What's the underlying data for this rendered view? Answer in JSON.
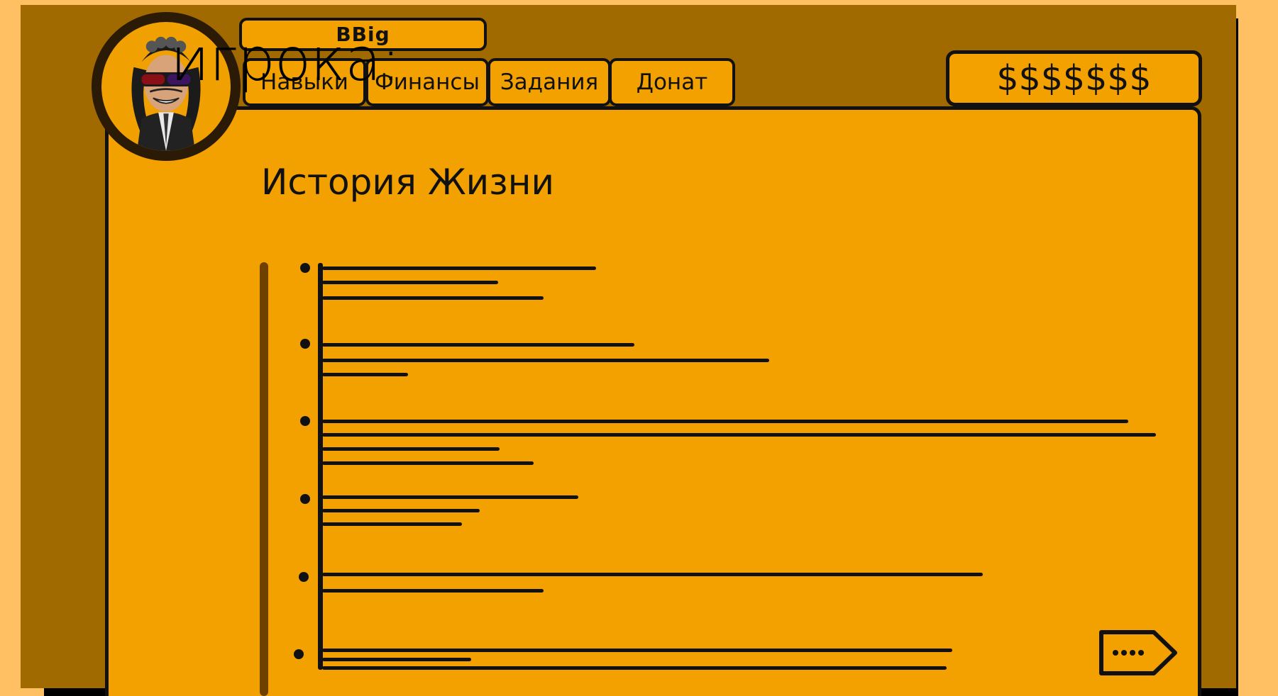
{
  "brand": {
    "label": "BBig"
  },
  "overlay_caption": "игрока:",
  "tabs": [
    {
      "label": "Навыки"
    },
    {
      "label": "Финансы"
    },
    {
      "label": "Задания"
    },
    {
      "label": "Донат"
    }
  ],
  "balance": {
    "label": "$$$$$$$"
  },
  "page": {
    "title": "История Жизни"
  },
  "colors": {
    "panel": "#f2a100",
    "frame": "#a06a00",
    "background": "#ffc063",
    "ink": "#111111"
  },
  "icons": {
    "avatar": "player-avatar-icon",
    "next": "next-arrow-icon"
  }
}
